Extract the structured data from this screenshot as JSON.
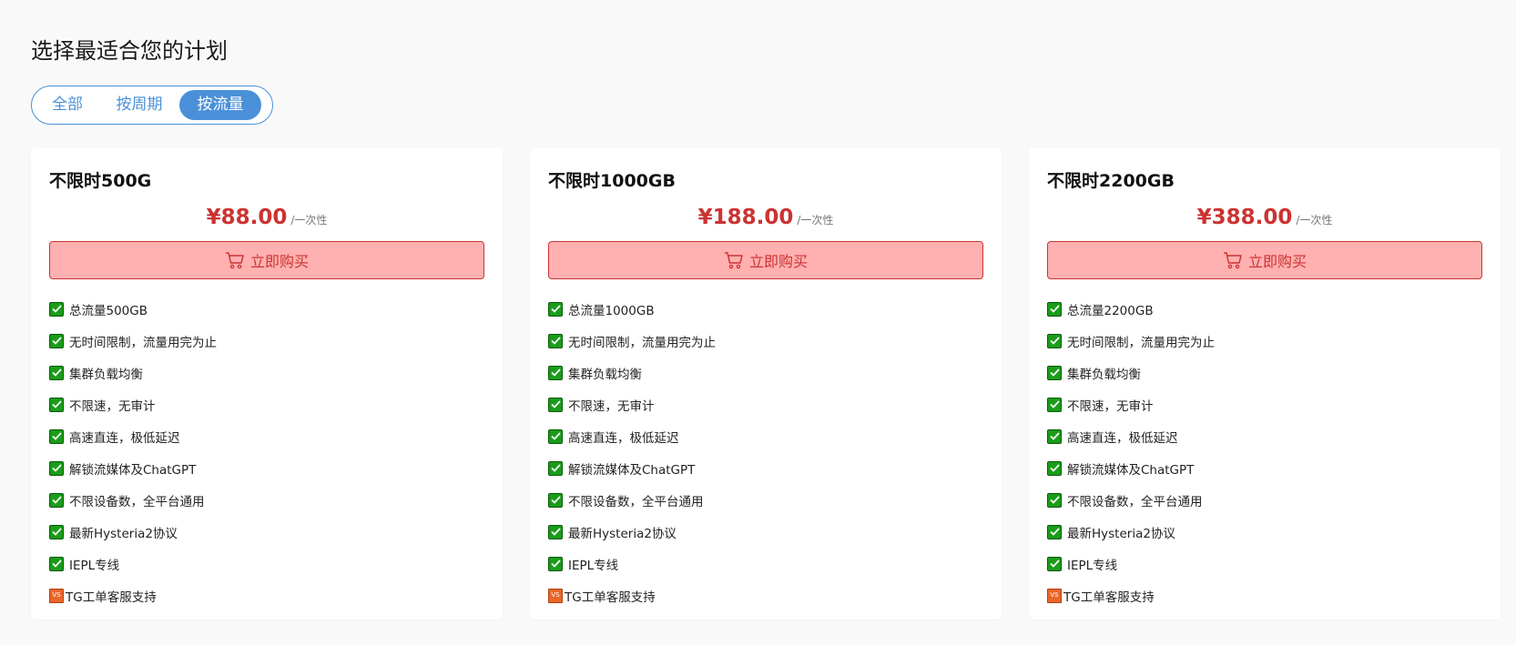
{
  "page": {
    "title": "选择最适合您的计划"
  },
  "tabs": [
    {
      "label": "全部",
      "active": false
    },
    {
      "label": "按周期",
      "active": false
    },
    {
      "label": "按流量",
      "active": true
    }
  ],
  "colors": {
    "accent": "#4a90d9",
    "price": "#cc3333",
    "button_bg": "#ffb0b0",
    "check": "#1a9c1a",
    "vs_badge": "#e8672a"
  },
  "plans": [
    {
      "title": "不限时500G",
      "price": "¥88.00",
      "period": "/一次性",
      "buy_label": "立即购买",
      "features": [
        {
          "icon": "check-icon",
          "text": "总流量500GB"
        },
        {
          "icon": "check-icon",
          "text": "无时间限制，流量用完为止"
        },
        {
          "icon": "check-icon",
          "text": "集群负载均衡"
        },
        {
          "icon": "check-icon",
          "text": "不限速，无审计"
        },
        {
          "icon": "check-icon",
          "text": "高速直连，极低延迟"
        },
        {
          "icon": "check-icon",
          "text": "解锁流媒体及ChatGPT"
        },
        {
          "icon": "check-icon",
          "text": "不限设备数，全平台通用"
        },
        {
          "icon": "check-icon",
          "text": "最新Hysteria2协议"
        },
        {
          "icon": "check-icon",
          "text": "IEPL专线"
        },
        {
          "icon": "vs-icon",
          "text": "TG工单客服支持"
        }
      ]
    },
    {
      "title": "不限时1000GB",
      "price": "¥188.00",
      "period": "/一次性",
      "buy_label": "立即购买",
      "features": [
        {
          "icon": "check-icon",
          "text": "总流量1000GB"
        },
        {
          "icon": "check-icon",
          "text": "无时间限制，流量用完为止"
        },
        {
          "icon": "check-icon",
          "text": "集群负载均衡"
        },
        {
          "icon": "check-icon",
          "text": "不限速，无审计"
        },
        {
          "icon": "check-icon",
          "text": "高速直连，极低延迟"
        },
        {
          "icon": "check-icon",
          "text": "解锁流媒体及ChatGPT"
        },
        {
          "icon": "check-icon",
          "text": "不限设备数，全平台通用"
        },
        {
          "icon": "check-icon",
          "text": "最新Hysteria2协议"
        },
        {
          "icon": "check-icon",
          "text": "IEPL专线"
        },
        {
          "icon": "vs-icon",
          "text": "TG工单客服支持"
        }
      ]
    },
    {
      "title": "不限时2200GB",
      "price": "¥388.00",
      "period": "/一次性",
      "buy_label": "立即购买",
      "features": [
        {
          "icon": "check-icon",
          "text": "总流量2200GB"
        },
        {
          "icon": "check-icon",
          "text": "无时间限制，流量用完为止"
        },
        {
          "icon": "check-icon",
          "text": "集群负载均衡"
        },
        {
          "icon": "check-icon",
          "text": "不限速，无审计"
        },
        {
          "icon": "check-icon",
          "text": "高速直连，极低延迟"
        },
        {
          "icon": "check-icon",
          "text": "解锁流媒体及ChatGPT"
        },
        {
          "icon": "check-icon",
          "text": "不限设备数，全平台通用"
        },
        {
          "icon": "check-icon",
          "text": "最新Hysteria2协议"
        },
        {
          "icon": "check-icon",
          "text": "IEPL专线"
        },
        {
          "icon": "vs-icon",
          "text": "TG工单客服支持"
        }
      ]
    }
  ]
}
